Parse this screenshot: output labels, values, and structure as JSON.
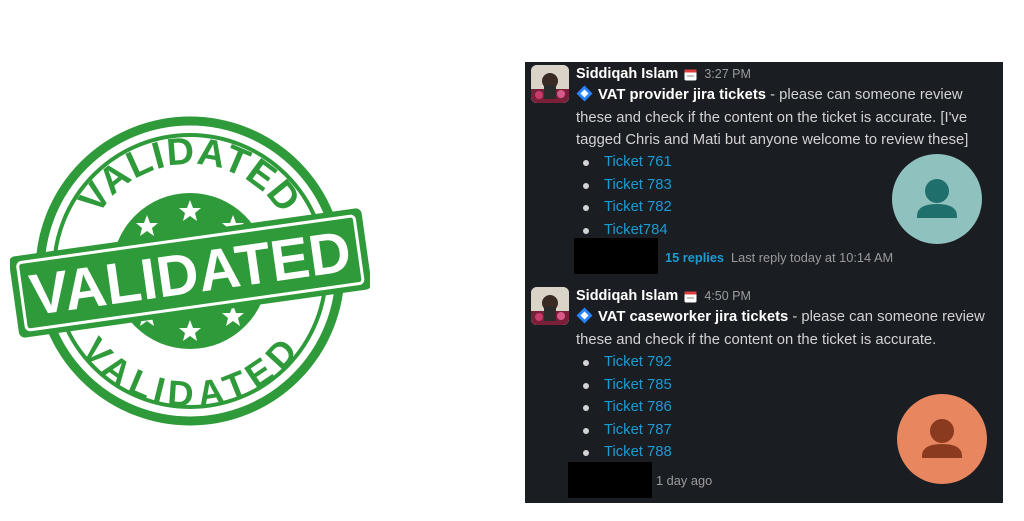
{
  "stamp": {
    "text_top": "VALIDATED",
    "text_center": "VALIDATED",
    "text_bottom": "VALIDATED",
    "color": "#2e9a3a"
  },
  "colors": {
    "panel_bg": "#1a1d21",
    "link": "#1d9bd1",
    "muted": "#9a9b9e",
    "avatar_teal_bg": "#8fc2bf",
    "avatar_teal_fg": "#1f6f6d",
    "avatar_orange_bg": "#e8865f",
    "avatar_orange_fg": "#8a3a1e"
  },
  "messages": [
    {
      "author": "Siddiqah Islam",
      "time": "3:27 PM",
      "title": "VAT provider jira tickets",
      "text": " - please can someone review these and check if the content on the ticket is accurate. [I've tagged Chris and Mati but anyone welcome to review these]",
      "tickets": [
        "Ticket 761",
        "Ticket 783",
        "Ticket 782",
        "Ticket784"
      ],
      "replies": "15 replies",
      "last_reply": "Last reply today at 10:14 AM"
    },
    {
      "author": "Siddiqah Islam",
      "time": "4:50 PM",
      "title": "VAT caseworker jira tickets",
      "text": " - please can someone review these and check if the content on the ticket is accurate.",
      "tickets": [
        "Ticket 792",
        "Ticket 785",
        "Ticket 786",
        "Ticket 787",
        "Ticket 788"
      ],
      "age": "1 day ago"
    }
  ]
}
